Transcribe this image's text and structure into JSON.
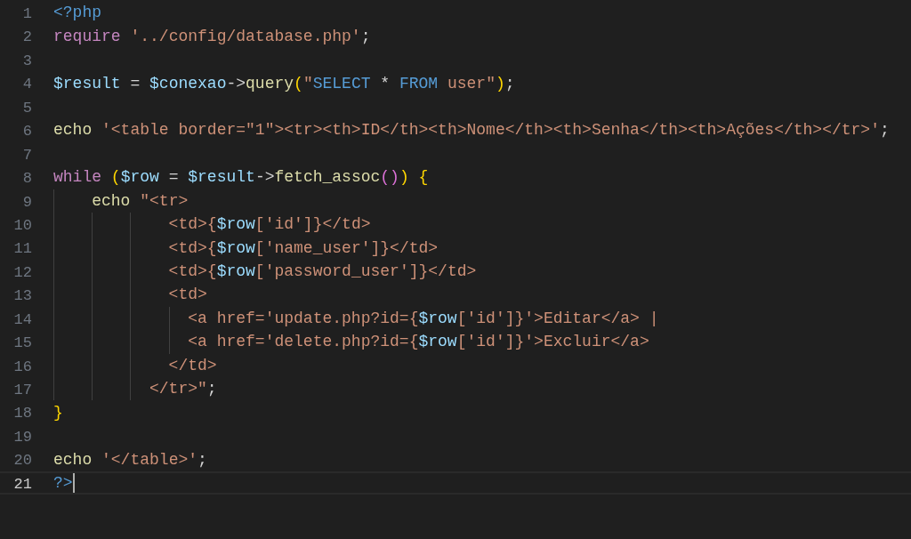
{
  "editor": {
    "lines": [
      {
        "number": "1",
        "current": false,
        "tokens": [
          {
            "text": "<?php",
            "kind": "tag"
          }
        ]
      },
      {
        "number": "2",
        "current": false,
        "tokens": [
          {
            "text": "require",
            "kind": "keyword"
          },
          {
            "text": " '../config/database.php'",
            "kind": "string"
          },
          {
            "text": ";",
            "kind": "plain"
          }
        ]
      },
      {
        "number": "3",
        "current": false
      },
      {
        "number": "4",
        "current": false,
        "tokens": [
          {
            "text": "$result",
            "kind": "variable"
          },
          {
            "text": " = ",
            "kind": "plain"
          },
          {
            "text": "$conexao",
            "kind": "variable"
          },
          {
            "text": "->",
            "kind": "plain"
          },
          {
            "text": "query",
            "kind": "function"
          },
          {
            "text": "(",
            "kind": "bracket1"
          },
          {
            "text": "\"",
            "kind": "string"
          },
          {
            "text": "SELECT",
            "kind": "sql"
          },
          {
            "text": " * ",
            "kind": "plain"
          },
          {
            "text": "FROM",
            "kind": "sql"
          },
          {
            "text": " user\"",
            "kind": "string"
          },
          {
            "text": ")",
            "kind": "bracket1"
          },
          {
            "text": ";",
            "kind": "plain"
          }
        ]
      },
      {
        "number": "5",
        "current": false
      },
      {
        "number": "6",
        "current": false,
        "tokens": [
          {
            "text": "echo",
            "kind": "function"
          },
          {
            "text": " '<table border=\"1\"><tr><th>ID</th><th>Nome</th><th>Senha</th><th>Ações</th></tr>'",
            "kind": "string"
          },
          {
            "text": ";",
            "kind": "plain"
          }
        ]
      },
      {
        "number": "7",
        "current": false
      },
      {
        "number": "8",
        "current": false,
        "tokens": [
          {
            "text": "while ",
            "kind": "keyword"
          },
          {
            "text": "(",
            "kind": "bracket1"
          },
          {
            "text": "$row",
            "kind": "variable"
          },
          {
            "text": " = ",
            "kind": "plain"
          },
          {
            "text": "$result",
            "kind": "variable"
          },
          {
            "text": "->",
            "kind": "plain"
          },
          {
            "text": "fetch_assoc",
            "kind": "function"
          },
          {
            "text": "()",
            "kind": "bracket2"
          },
          {
            "text": ") {",
            "kind": "bracket1"
          }
        ]
      },
      {
        "number": "9",
        "current": false,
        "tokens": [
          {
            "text": "    echo",
            "kind": "function"
          },
          {
            "text": " \"<tr>",
            "kind": "string"
          }
        ]
      },
      {
        "number": "10",
        "current": false,
        "tokens": [
          {
            "text": "            <td>{",
            "kind": "string"
          },
          {
            "text": "$row",
            "kind": "variable"
          },
          {
            "text": "['id']}</td>",
            "kind": "string"
          }
        ]
      },
      {
        "number": "11",
        "current": false,
        "tokens": [
          {
            "text": "            <td>{",
            "kind": "string"
          },
          {
            "text": "$row",
            "kind": "variable"
          },
          {
            "text": "['name_user']}</td>",
            "kind": "string"
          }
        ]
      },
      {
        "number": "12",
        "current": false,
        "tokens": [
          {
            "text": "            <td>{",
            "kind": "string"
          },
          {
            "text": "$row",
            "kind": "variable"
          },
          {
            "text": "['password_user']}</td>",
            "kind": "string"
          }
        ]
      },
      {
        "number": "13",
        "current": false,
        "tokens": [
          {
            "text": "            <td>",
            "kind": "string"
          }
        ]
      },
      {
        "number": "14",
        "current": false,
        "tokens": [
          {
            "text": "              <a href='update.php?id={",
            "kind": "string"
          },
          {
            "text": "$row",
            "kind": "variable"
          },
          {
            "text": "['id']}'>Editar</a> |",
            "kind": "string"
          }
        ]
      },
      {
        "number": "15",
        "current": false,
        "tokens": [
          {
            "text": "              <a href='delete.php?id={",
            "kind": "string"
          },
          {
            "text": "$row",
            "kind": "variable"
          },
          {
            "text": "['id']}'>Excluir</a>",
            "kind": "string"
          }
        ]
      },
      {
        "number": "16",
        "current": false,
        "tokens": [
          {
            "text": "            </td>",
            "kind": "string"
          }
        ]
      },
      {
        "number": "17",
        "current": false,
        "tokens": [
          {
            "text": "          </tr>\"",
            "kind": "string"
          },
          {
            "text": ";",
            "kind": "plain"
          }
        ]
      },
      {
        "number": "18",
        "current": false,
        "tokens": [
          {
            "text": "}",
            "kind": "bracket1"
          }
        ]
      },
      {
        "number": "19",
        "current": false
      },
      {
        "number": "20",
        "current": false,
        "tokens": [
          {
            "text": "echo",
            "kind": "function"
          },
          {
            "text": " '</table>'",
            "kind": "string"
          },
          {
            "text": ";",
            "kind": "plain"
          }
        ]
      },
      {
        "number": "21",
        "current": true,
        "tokens": [
          {
            "text": "?>",
            "kind": "tag"
          }
        ]
      }
    ]
  }
}
